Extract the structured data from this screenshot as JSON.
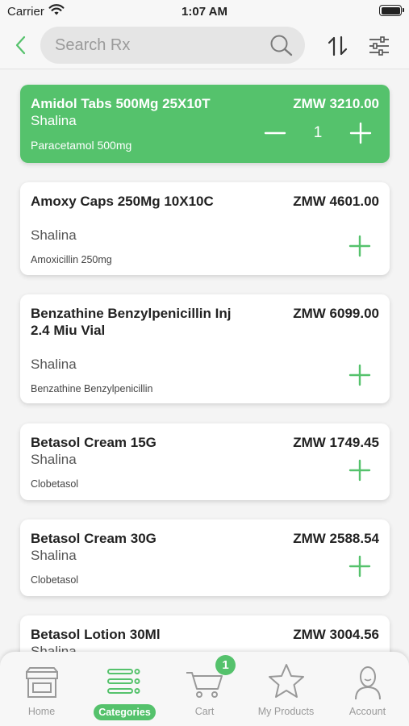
{
  "status_bar": {
    "carrier": "Carrier",
    "time": "1:07 AM"
  },
  "search": {
    "placeholder": "Search Rx",
    "value": ""
  },
  "colors": {
    "accent": "#55c26c",
    "text": "#222222",
    "muted": "#9a9a9a"
  },
  "products": [
    {
      "name": "Amidol Tabs 500Mg 25X10T",
      "brand": "Shalina",
      "generic": "Paracetamol 500mg",
      "price": "ZMW 3210.00",
      "quantity": "1",
      "selected": true
    },
    {
      "name": "Amoxy Caps 250Mg 10X10C",
      "brand": "Shalina",
      "generic": "Amoxicillin 250mg",
      "price": "ZMW 4601.00",
      "selected": false
    },
    {
      "name": "Benzathine Benzylpenicillin Inj 2.4 Miu Vial",
      "brand": "Shalina",
      "generic": "Benzathine Benzylpenicillin",
      "price": "ZMW 6099.00",
      "selected": false
    },
    {
      "name": "Betasol Cream 15G",
      "brand": "Shalina",
      "generic": "Clobetasol",
      "price": "ZMW 1749.45",
      "selected": false
    },
    {
      "name": "Betasol Cream 30G",
      "brand": "Shalina",
      "generic": "Clobetasol",
      "price": "ZMW 2588.54",
      "selected": false
    },
    {
      "name": "Betasol Lotion 30Ml",
      "brand": "Shalina",
      "generic": "",
      "price": "ZMW 3004.56",
      "selected": false
    }
  ],
  "tabs": [
    {
      "label": "Home",
      "icon": "store-icon",
      "active": false
    },
    {
      "label": "Categories",
      "icon": "list-icon",
      "active": true
    },
    {
      "label": "Cart",
      "icon": "cart-icon",
      "active": false,
      "badge": "1"
    },
    {
      "label": "My Products",
      "icon": "star-icon",
      "active": false
    },
    {
      "label": "Account",
      "icon": "user-icon",
      "active": false
    }
  ]
}
